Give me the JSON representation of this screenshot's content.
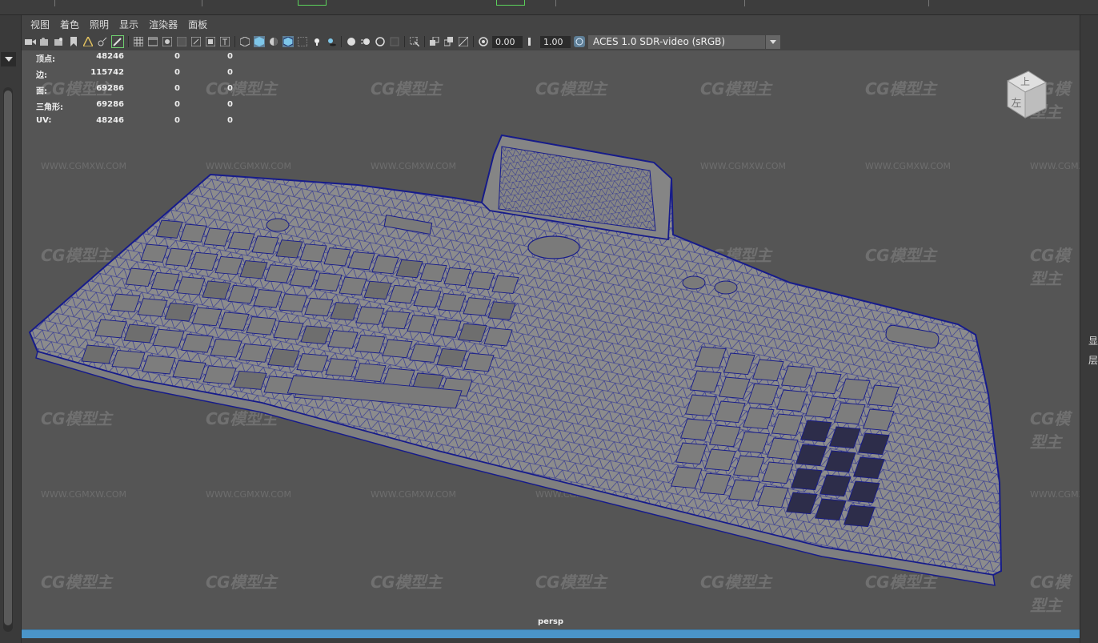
{
  "menu": {
    "items": [
      "视图",
      "着色",
      "照明",
      "显示",
      "渲染器",
      "面板"
    ]
  },
  "toolbar": {
    "exposure_value": "0.00",
    "gamma_value": "1.00",
    "color_space": "ACES 1.0 SDR-video (sRGB)",
    "icons": [
      "camera-select-icon",
      "camera-attributes-icon",
      "bookmark-icon",
      "image-plane-icon",
      "2d-pan-icon",
      "grease-pencil-icon",
      "grid-icon",
      "film-gate-icon",
      "resolution-gate-icon",
      "gate-mask-icon",
      "field-chart-icon",
      "safe-action-icon",
      "safe-title-icon",
      "wireframe-icon",
      "smooth-shade-icon",
      "default-material-icon",
      "wireframe-on-shaded-icon",
      "xray-icon",
      "use-all-lights-icon",
      "shadows-icon",
      "screen-space-ao-icon",
      "motion-blur-icon",
      "multisample-aa-icon",
      "depth-of-field-icon",
      "isolate-select-icon",
      "xray-joints-icon",
      "xray-active-icon",
      "backface-icon",
      "exposure-icon",
      "gamma-icon",
      "color-management-icon"
    ]
  },
  "hud": {
    "rows": [
      {
        "label": "顶点:",
        "v1": "48246",
        "v2": "0",
        "v3": "0"
      },
      {
        "label": "边:",
        "v1": "115742",
        "v2": "0",
        "v3": "0"
      },
      {
        "label": "面:",
        "v1": "69286",
        "v2": "0",
        "v3": "0"
      },
      {
        "label": "三角形:",
        "v1": "69286",
        "v2": "0",
        "v3": "0"
      },
      {
        "label": "UV:",
        "v1": "48246",
        "v2": "0",
        "v3": "0"
      }
    ]
  },
  "viewcube": {
    "top_face": "上",
    "left_face": "左"
  },
  "camera_label": "persp",
  "right_panel": {
    "chars": [
      "显",
      "层"
    ]
  },
  "watermark": {
    "logo": "CG模型主",
    "url": "WWW.CGMXW.COM"
  },
  "colors": {
    "viewport_bg": "#555555",
    "wireframe": "#1a1f8a",
    "timeline_bar": "#4a95c9"
  }
}
